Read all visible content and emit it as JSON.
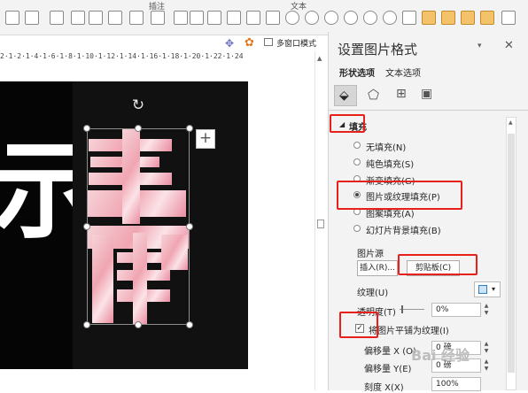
{
  "toolbar": {
    "group_label_left": "插注",
    "group_label_right": "文本",
    "multi_window_label": "多窗口模式"
  },
  "ruler": {
    "ticks": "2·1·2·1·4·1·6·1·8·1·10·1·12·1·14·1·16·1·18·1·20·1·22·1·24"
  },
  "slide": {
    "char_left": "示",
    "char_main": "春"
  },
  "pane": {
    "title": "设置图片格式",
    "tabs": [
      "形状选项",
      "文本选项"
    ],
    "section_fill": "填充",
    "fill_options": [
      {
        "label": "无填充(N)",
        "selected": false
      },
      {
        "label": "纯色填充(S)",
        "selected": false
      },
      {
        "label": "渐变填充(G)",
        "selected": false
      },
      {
        "label": "图片或纹理填充(P)",
        "selected": true
      },
      {
        "label": "图案填充(A)",
        "selected": false
      },
      {
        "label": "幻灯片背景填充(B)",
        "selected": false
      }
    ],
    "picture_source_label": "图片源",
    "insert_button": "插入(R)...",
    "clipboard_button": "剪贴板(C)",
    "texture_label": "纹理(U)",
    "transparency_label": "透明度(T)",
    "transparency_value": "0%",
    "tile_checkbox_label": "将图片平铺为纹理(I)",
    "tile_checked": true,
    "offset_x_label": "偏移量 X (O)",
    "offset_x_value": "0 磅",
    "offset_y_label": "偏移量 Y(E)",
    "offset_y_value": "0 磅",
    "scale_x_label": "刻度 X(X)",
    "scale_x_value": "100%"
  },
  "watermark": "Bai 经验",
  "colors": {
    "highlight": "#e8201c",
    "pane_bg": "#f3f3f3",
    "slide_bg": "#050505"
  }
}
